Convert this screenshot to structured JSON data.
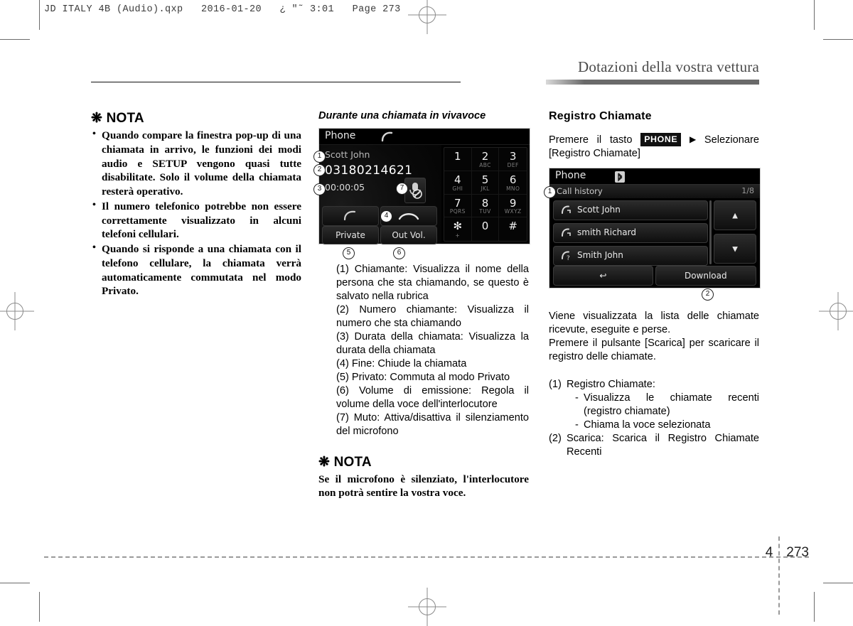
{
  "slug": "JD ITALY 4B (Audio).qxp   2016-01-20   ¿ \"˜ 3:01   Page 273",
  "header": {
    "title": "Dotazioni della vostra vettura"
  },
  "footer": {
    "chapter": "4",
    "page": "273"
  },
  "left_column": {
    "nota_title": "❋ NOTA",
    "bullets": [
      "Quando compare la finestra pop-up di una chiamata in arrivo, le funzioni dei modi audio e SETUP vengono quasi tutte disabilitate. Solo il volume della chiamata resterà operativo.",
      "Il numero telefonico potrebbe non essere correttamente visualizzato in alcuni telefoni cellulari.",
      "Quando si risponde a una chiamata con il telefono cellulare, la chiamata verrà automaticamente commutata nel modo Privato."
    ]
  },
  "middle_column": {
    "subheading": "Durante una chiamata in vivavoce",
    "screenshot": {
      "title": "Phone",
      "caller_name": "Scott John",
      "caller_number": "03180214621",
      "duration": "00:00:05",
      "private_label": "Private",
      "outvol_label": "Out Vol.",
      "keypad": [
        {
          "digit": "1",
          "letters": ""
        },
        {
          "digit": "2",
          "letters": "ABC"
        },
        {
          "digit": "3",
          "letters": "DEF"
        },
        {
          "digit": "4",
          "letters": "GHI"
        },
        {
          "digit": "5",
          "letters": "JKL"
        },
        {
          "digit": "6",
          "letters": "MNO"
        },
        {
          "digit": "7",
          "letters": "PQRS"
        },
        {
          "digit": "8",
          "letters": "TUV"
        },
        {
          "digit": "9",
          "letters": "WXYZ"
        },
        {
          "digit": "✻",
          "letters": "+"
        },
        {
          "digit": "0",
          "letters": ""
        },
        {
          "digit": "#",
          "letters": ""
        }
      ],
      "callouts": [
        "1",
        "2",
        "3",
        "4",
        "5",
        "6",
        "7"
      ]
    },
    "items": [
      "(1) Chiamante: Visualizza il nome della persona che sta chiamando, se questo è salvato nella rubrica",
      "(2) Numero chiamante: Visualizza il numero che sta chiamando",
      "(3) Durata della chiamata: Visualizza la durata della chiamata",
      "(4) Fine: Chiude la chiamata",
      "(5) Privato: Commuta al modo Privato",
      "(6) Volume di emissione: Regola il volume della voce dell'interlocutore",
      "(7) Muto: Attiva/disattiva il silenziamento del microfono"
    ],
    "nota_title": "❋ NOTA",
    "nota_text": "Se il microfono è silenziato, l'interlocutore non potrà sentire la vostra voce."
  },
  "right_column": {
    "heading": "Registro Chiamate",
    "intro_pre": "Premere il tasto",
    "intro_key": "PHONE",
    "intro_post": "Selezionare [Registro Chiamate]",
    "screenshot": {
      "title": "Phone",
      "subtitle": "Call history",
      "page_indicator": "1/8",
      "entries": [
        {
          "name": "Scott John",
          "type": "outgoing"
        },
        {
          "name": "smith Richard",
          "type": "outgoing"
        },
        {
          "name": "Smith John",
          "type": "missed"
        }
      ],
      "back_label": "↩",
      "download_label": "Download",
      "up_label": "▲",
      "down_label": "▼",
      "callouts": [
        "1",
        "2"
      ]
    },
    "paragraphs": [
      "Viene visualizzata la lista delle chiamate ricevute, eseguite e perse.",
      "Premere il pulsante [Scarica] per scaricare il registro delle chiamate."
    ],
    "items": [
      {
        "num": "(1)",
        "text": "Registro Chiamate:",
        "sub": [
          "Visualizza le chiamate recenti (registro chiamate)",
          "Chiama la voce selezionata"
        ]
      },
      {
        "num": "(2)",
        "text": "Scarica: Scarica il Registro Chiamate Recenti",
        "sub": []
      }
    ]
  }
}
